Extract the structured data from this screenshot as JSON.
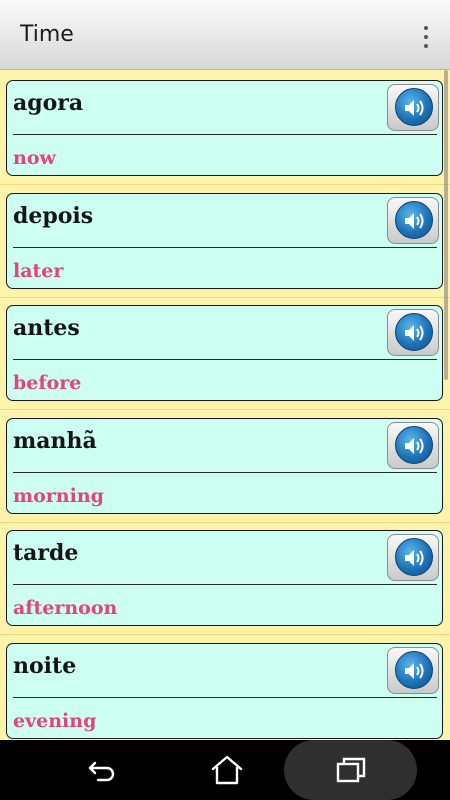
{
  "app": {
    "title": "Time",
    "overflow_icon": "more-vert-icon"
  },
  "items": [
    {
      "word": "agora",
      "translation": "now",
      "icon": "speaker-icon"
    },
    {
      "word": "depois",
      "translation": "later",
      "icon": "speaker-icon"
    },
    {
      "word": "antes",
      "translation": "before",
      "icon": "speaker-icon"
    },
    {
      "word": "manhã",
      "translation": "morning",
      "icon": "speaker-icon"
    },
    {
      "word": "tarde",
      "translation": "afternoon",
      "icon": "speaker-icon"
    },
    {
      "word": "noite",
      "translation": "evening",
      "icon": "speaker-icon"
    }
  ],
  "colors": {
    "background": "#fef3ab",
    "card": "#ccfff1",
    "translation": "#e2447b",
    "speaker": "#1d73b8"
  },
  "nav": {
    "back_icon": "back-icon",
    "home_icon": "home-icon",
    "recents_icon": "recents-icon"
  }
}
